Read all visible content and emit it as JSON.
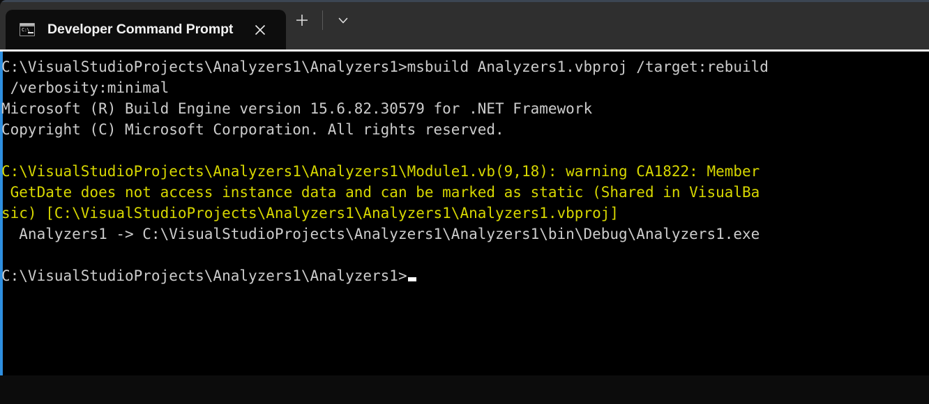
{
  "window": {
    "accent_color": "#2e8fe0",
    "titlebar_color": "#2f2f2f",
    "terminal_background": "#000000"
  },
  "titlebar": {
    "tab": {
      "title": "Developer Command Prompt",
      "icon_name": "console-icon",
      "icon_glyph": "C:\\",
      "close_label": "×"
    },
    "new_tab_label": "+",
    "dropdown_label": "⌄"
  },
  "terminal": {
    "prompt_colors": {
      "normal": "#cccccc",
      "warning": "#d7d700"
    },
    "lines": [
      {
        "text": "C:\\VisualStudioProjects\\Analyzers1\\Analyzers1>msbuild Analyzers1.vbproj /target:rebuild",
        "color": "white"
      },
      {
        "text": " /verbosity:minimal",
        "color": "white"
      },
      {
        "text": "Microsoft (R) Build Engine version 15.6.82.30579 for .NET Framework",
        "color": "white"
      },
      {
        "text": "Copyright (C) Microsoft Corporation. All rights reserved.",
        "color": "white"
      },
      {
        "text": "",
        "color": "white"
      },
      {
        "text": "C:\\VisualStudioProjects\\Analyzers1\\Analyzers1\\Module1.vb(9,18): warning CA1822: Member",
        "color": "yellow"
      },
      {
        "text": " GetDate does not access instance data and can be marked as static (Shared in VisualBa",
        "color": "yellow"
      },
      {
        "text": "sic) [C:\\VisualStudioProjects\\Analyzers1\\Analyzers1\\Analyzers1.vbproj]",
        "color": "yellow"
      },
      {
        "text": "  Analyzers1 -> C:\\VisualStudioProjects\\Analyzers1\\Analyzers1\\bin\\Debug\\Analyzers1.exe",
        "color": "white"
      },
      {
        "text": "",
        "color": "white"
      },
      {
        "text": "C:\\VisualStudioProjects\\Analyzers1\\Analyzers1>",
        "color": "white",
        "cursor": true
      }
    ]
  }
}
